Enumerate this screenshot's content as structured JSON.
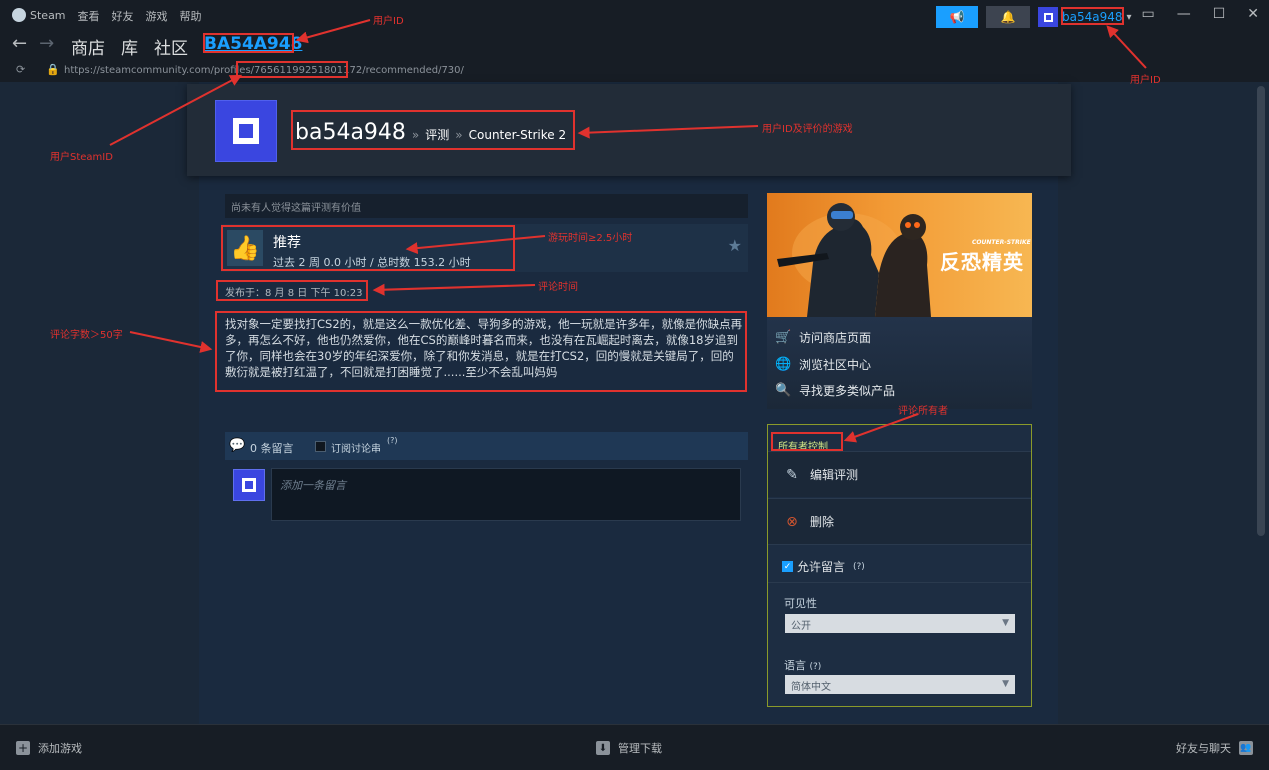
{
  "menu": {
    "app": "Steam",
    "items": [
      "查看",
      "好友",
      "游戏",
      "帮助"
    ]
  },
  "account": {
    "name": "ba54a948"
  },
  "nav": {
    "links": [
      "商店",
      "库",
      "社区"
    ],
    "active": "BA54A948"
  },
  "url": {
    "prefix": "https://steamcommunity.com/profiles/",
    "id": "76561199251801172",
    "suffix": "/recommended/730/"
  },
  "header": {
    "username": "ba54a948",
    "sep1": "»",
    "crumb1": "评测",
    "sep2": "»",
    "game": "Counter-Strike 2"
  },
  "review": {
    "helpful": "尚未有人觉得这篇评测有价值",
    "label": "推荐",
    "hours": "过去 2 周 0.0 小时 / 总时数 153.2 小时",
    "posted": "发布于：8 月 8 日 下午 10:23",
    "text": "找对象一定要找打CS2的，就是这么一款优化差、导狗多的游戏，他一玩就是许多年，就像是你缺点再多，再怎么不好，他也仍然爱你，他在CS的巅峰时暮名而来，也没有在瓦崛起时离去，就像18岁追到了你，同样也会在30岁的年纪深爱你，除了和你发消息，就是在打CS2，回的慢就是关键局了，回的敷衍就是被打红温了，不回就是打困睡觉了......至少不会乱叫妈妈"
  },
  "comments": {
    "count": "0 条留言",
    "subscribe": "订阅讨论串",
    "q": "(?)",
    "placeholder": "添加一条留言"
  },
  "banner": {
    "logo_en": "COUNTER-STRIKE",
    "logo_cn": "反恐精英"
  },
  "links": [
    "访问商店页面",
    "浏览社区中心",
    "寻找更多类似产品"
  ],
  "owner": {
    "head": "所有者控制",
    "edit": "编辑评测",
    "delete": "删除",
    "allow": "允许留言",
    "allow_q": "(?)",
    "visibility_label": "可见性",
    "visibility_value": "公开",
    "language_label": "语言",
    "language_q": "(?)",
    "language_value": "简体中文"
  },
  "bottom": {
    "add_game": "添加游戏",
    "downloads": "管理下载",
    "friends": "好友与聊天"
  },
  "annotations": {
    "user_id_nav": "用户ID",
    "user_id_acct": "用户ID",
    "steam_id": "用户SteamID",
    "user_and_game": "用户ID及评价的游戏",
    "playtime": "游玩时间≥2.5小时",
    "review_time": "评论时间",
    "word_count": "评论字数＞50字",
    "owner": "评论所有者"
  },
  "colors": {
    "accent": "#1a9fff",
    "annotation": "#e0322e",
    "owner_border": "#8a9a2a"
  }
}
